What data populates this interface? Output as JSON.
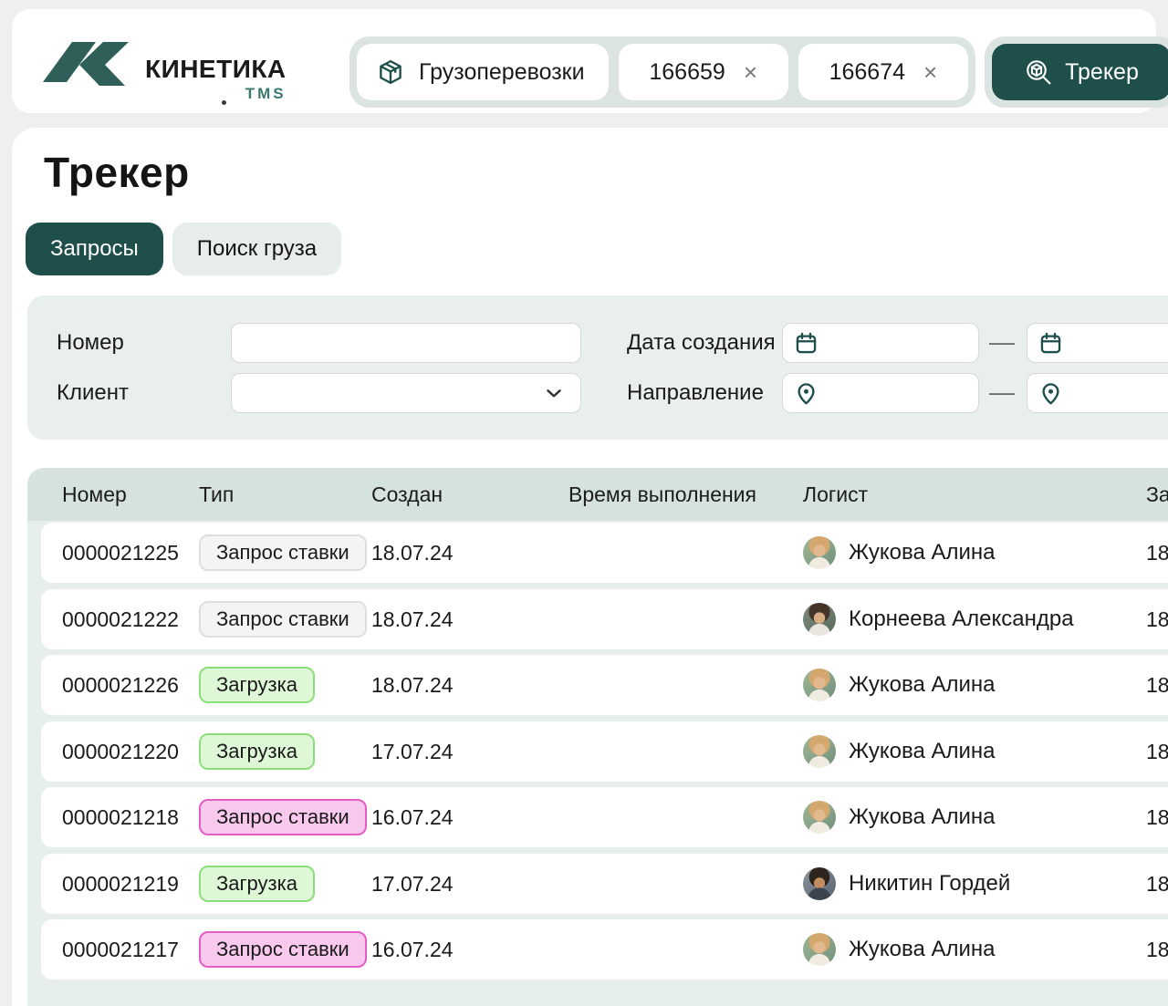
{
  "colors": {
    "accent_dark_teal": "#1e4f4a",
    "logo_teal": "#2e5f58",
    "page_background": "#efefef",
    "strip_background": "#dce4e1",
    "filter_panel_background": "#e9efec",
    "table_header_background": "#d6e2df",
    "badge_gray_bg": "#f4f4f4",
    "badge_gray_border": "#dedede",
    "badge_green_bg": "#def8d7",
    "badge_green_border": "#8bdf7b",
    "badge_pink_bg": "#f8c9ec",
    "badge_pink_border": "#e55cc7"
  },
  "brand": {
    "name": "КИНЕТИКА",
    "suffix": "TMS"
  },
  "topbar": {
    "module_tab": {
      "label": "Грузоперевозки",
      "icon": "package-icon"
    },
    "order_tabs": [
      {
        "label": "166659",
        "close": "×"
      },
      {
        "label": "166674",
        "close": "×"
      }
    ],
    "tracker_tab": {
      "label": "Трекер",
      "icon": "tracker-search-icon"
    }
  },
  "page": {
    "title": "Трекер"
  },
  "view_tabs": {
    "requests": "Запросы",
    "cargo_search": "Поиск груза"
  },
  "filters": {
    "number": {
      "label": "Номер",
      "value": ""
    },
    "client": {
      "label": "Клиент",
      "value": ""
    },
    "date_created": {
      "label": "Дата создания",
      "from": "",
      "to": "",
      "separator": "—"
    },
    "direction": {
      "label": "Направление",
      "from": "",
      "to": "",
      "separator": "—"
    }
  },
  "table": {
    "columns": {
      "number": "Номер",
      "type": "Тип",
      "created": "Создан",
      "exec_time": "Время выполнения",
      "logist": "Логист",
      "last_clipped": "За"
    },
    "rows": [
      {
        "number": "0000021225",
        "type": "Запрос ставки",
        "type_variant": "gray",
        "created": "18.07.24",
        "exec_time": "",
        "logist": "Жукова Алина",
        "avatar": "woman-blonde",
        "last_clipped": "18"
      },
      {
        "number": "0000021222",
        "type": "Запрос ставки",
        "type_variant": "gray",
        "created": "18.07.24",
        "exec_time": "",
        "logist": "Корнеева Александра",
        "avatar": "woman-brunette",
        "last_clipped": "18"
      },
      {
        "number": "0000021226",
        "type": "Загрузка",
        "type_variant": "green",
        "created": "18.07.24",
        "exec_time": "",
        "logist": "Жукова Алина",
        "avatar": "woman-blonde",
        "last_clipped": "18"
      },
      {
        "number": "0000021220",
        "type": "Загрузка",
        "type_variant": "green",
        "created": "17.07.24",
        "exec_time": "",
        "logist": "Жукова Алина",
        "avatar": "woman-blonde",
        "last_clipped": "18"
      },
      {
        "number": "0000021218",
        "type": "Запрос ставки",
        "type_variant": "pink",
        "created": "16.07.24",
        "exec_time": "",
        "logist": "Жукова Алина",
        "avatar": "woman-blonde",
        "last_clipped": "18"
      },
      {
        "number": "0000021219",
        "type": "Загрузка",
        "type_variant": "green",
        "created": "17.07.24",
        "exec_time": "",
        "logist": "Никитин Гордей",
        "avatar": "man",
        "last_clipped": "18"
      },
      {
        "number": "0000021217",
        "type": "Запрос ставки",
        "type_variant": "pink",
        "created": "16.07.24",
        "exec_time": "",
        "logist": "Жукова Алина",
        "avatar": "woman-blonde",
        "last_clipped": "18"
      }
    ]
  }
}
